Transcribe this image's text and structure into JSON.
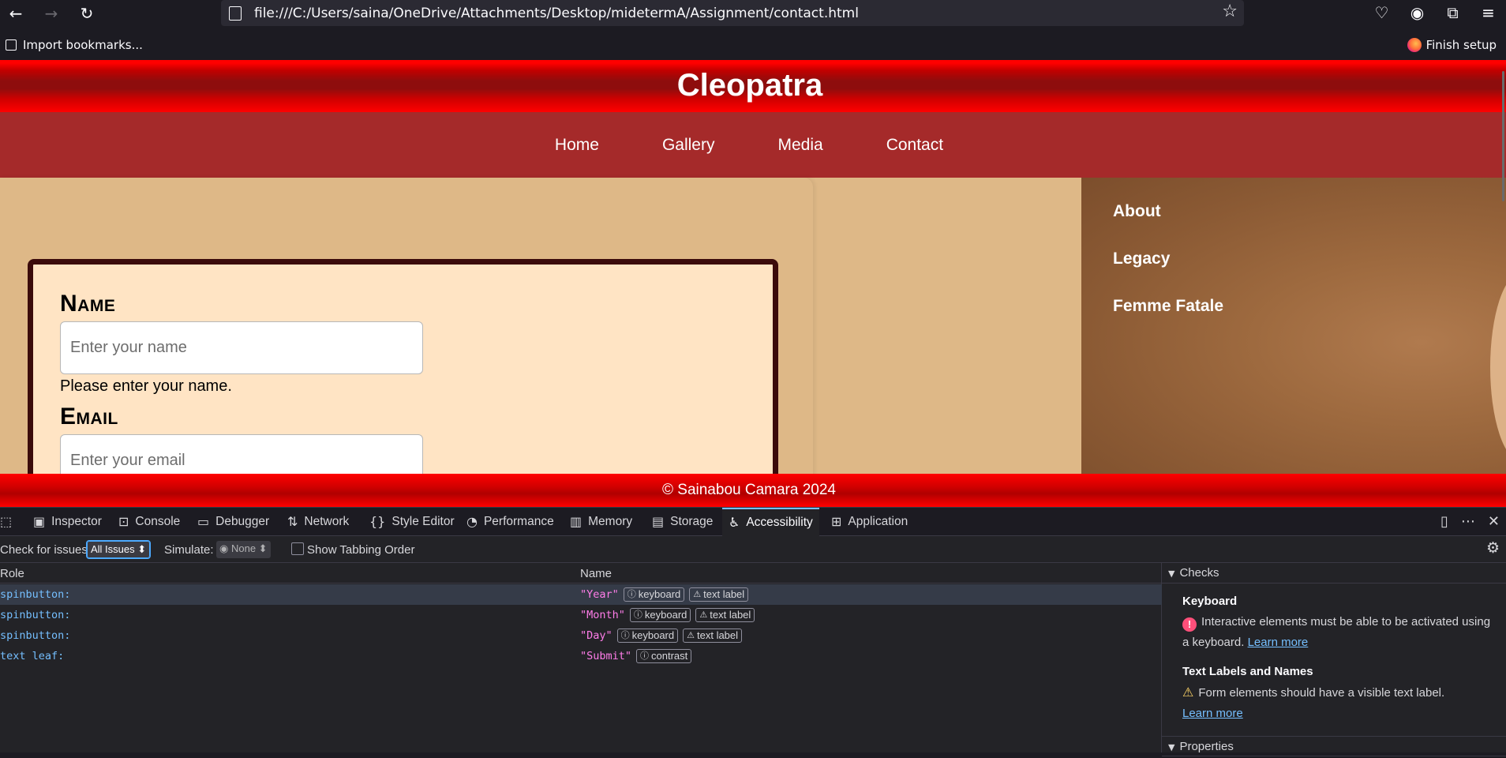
{
  "browser": {
    "url": "file:///C:/Users/saina/OneDrive/Attachments/Desktop/midetermA/Assignment/contact.html",
    "bookmarks": {
      "import_label": "Import bookmarks...",
      "finish_label": "Finish setup"
    }
  },
  "site": {
    "title": "Cleopatra",
    "nav": [
      "Home",
      "Gallery",
      "Media",
      "Contact"
    ],
    "form": {
      "name_label": "Name",
      "name_placeholder": "Enter your name",
      "name_hint": "Please enter your name.",
      "email_label": "Email",
      "email_placeholder": "Enter your email"
    },
    "side_links": [
      "About",
      "Legacy",
      "Femme Fatale"
    ],
    "footer": "© Sainabou Camara 2024"
  },
  "devtools": {
    "tabs": [
      "Inspector",
      "Console",
      "Debugger",
      "Network",
      "Style Editor",
      "Performance",
      "Memory",
      "Storage",
      "Accessibility",
      "Application"
    ],
    "active_tab": "Accessibility",
    "check_label": "Check for issues:",
    "check_value": "All Issues",
    "simulate_label": "Simulate:",
    "simulate_value": "None",
    "tabbing_label": "Show Tabbing Order",
    "columns": {
      "role": "Role",
      "name": "Name"
    },
    "rows": [
      {
        "role": "spinbutton:",
        "name": "\"Year\"",
        "badges": [
          "keyboard",
          "text label"
        ]
      },
      {
        "role": "spinbutton:",
        "name": "\"Month\"",
        "badges": [
          "keyboard",
          "text label"
        ]
      },
      {
        "role": "spinbutton:",
        "name": "\"Day\"",
        "badges": [
          "keyboard",
          "text label"
        ]
      },
      {
        "role": "text leaf:",
        "name": "\"Submit\"",
        "badges": [
          "contrast"
        ]
      }
    ],
    "checks": {
      "header": "Checks",
      "keyboard_title": "Keyboard",
      "keyboard_text": "Interactive elements must be able to be activated using a keyboard.",
      "learn_more": "Learn more",
      "labels_title": "Text Labels and Names",
      "labels_text": "Form elements should have a visible text label.",
      "properties_header": "Properties"
    }
  }
}
